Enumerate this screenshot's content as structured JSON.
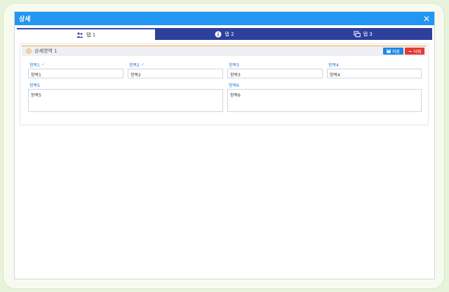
{
  "window": {
    "title": "상세",
    "close_glyph": "✕"
  },
  "tabs": [
    {
      "label": "탭 1",
      "icon": "user-group-icon",
      "active": true
    },
    {
      "label": "탭 2",
      "icon": "info-icon",
      "active": false
    },
    {
      "label": "탭 3",
      "icon": "windows-icon",
      "active": false
    }
  ],
  "section": {
    "title": "상세영역 1",
    "save_label": "저장",
    "delete_label": "삭제",
    "colors": {
      "accent": "#f0a845",
      "save": "#1e88e5",
      "delete": "#e53935"
    }
  },
  "fields": [
    {
      "label": "항목1",
      "value": "항목1",
      "check": true
    },
    {
      "label": "항목2",
      "value": "항목2",
      "check": true
    },
    {
      "label": "항목3",
      "value": "항목3",
      "check": false
    },
    {
      "label": "항목4",
      "value": "항목4",
      "check": false
    },
    {
      "label": "항목5",
      "value": "항목5",
      "check": false
    },
    {
      "label": "항목6",
      "value": "항목6",
      "check": false
    }
  ]
}
